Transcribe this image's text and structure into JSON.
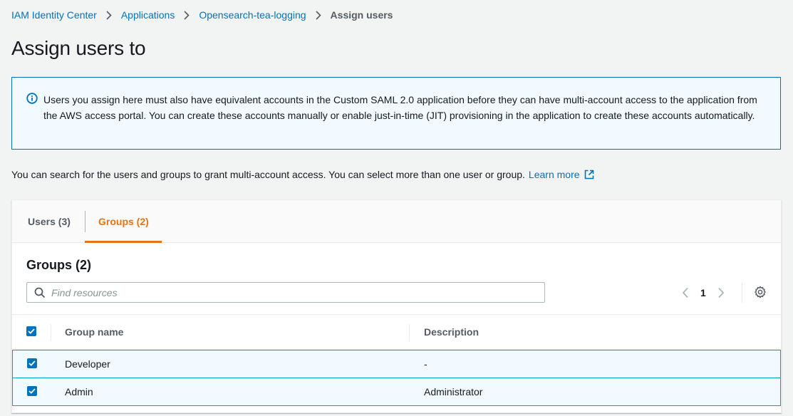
{
  "breadcrumb": {
    "items": [
      "IAM Identity Center",
      "Applications",
      "Opensearch-tea-logging",
      "Assign users"
    ]
  },
  "page": {
    "title": "Assign users to"
  },
  "alert": {
    "text": "Users you assign here must also have equivalent accounts in the Custom SAML 2.0 application before they can have multi-account access to the application from the AWS access portal. You can create these accounts manually or enable just-in-time (JIT) provisioning in the application to create these accounts automatically."
  },
  "help": {
    "text": "You can search for the users and groups to grant multi-account access. You can select more than one user or group.",
    "link_label": "Learn more"
  },
  "tabs": [
    {
      "label": "Users (3)",
      "active": false
    },
    {
      "label": "Groups (2)",
      "active": true
    }
  ],
  "panel": {
    "title": "Groups (2)",
    "search_placeholder": "Find resources",
    "search_value": "",
    "page_number": "1"
  },
  "table": {
    "columns": [
      "Group name",
      "Description"
    ],
    "rows": [
      {
        "name": "Developer",
        "description": "-",
        "selected": true
      },
      {
        "name": "Admin",
        "description": "Administrator",
        "selected": true
      }
    ]
  },
  "colors": {
    "link": "#0073bb",
    "active_tab": "#ec7211",
    "alert_bg": "#f1faff",
    "selected_row_border": "#00a1c9"
  }
}
